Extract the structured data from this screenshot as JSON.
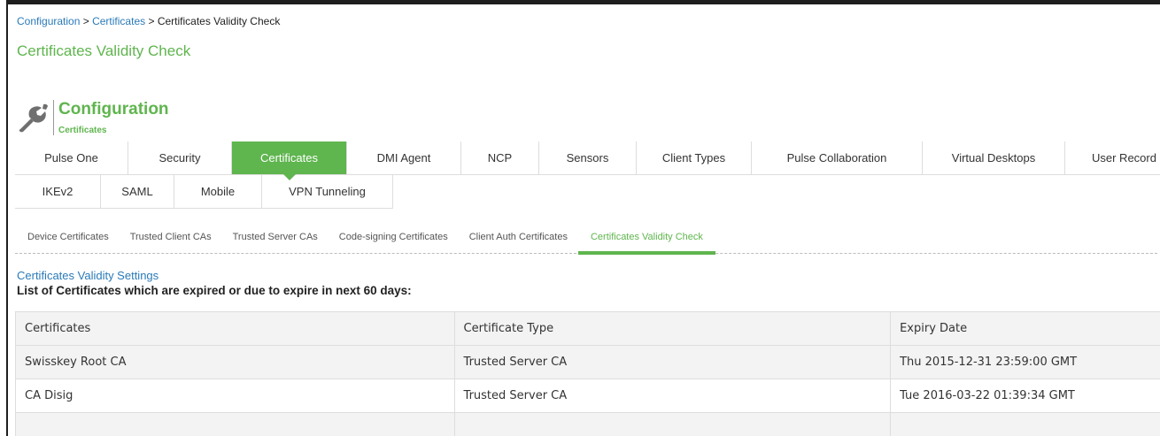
{
  "breadcrumb": {
    "items": [
      "Configuration",
      "Certificates",
      "Certificates Validity Check"
    ],
    "separator": ">"
  },
  "page_title": "Certificates Validity Check",
  "section": {
    "icon": "wrench-icon",
    "title": "Configuration",
    "subtitle": "Certificates"
  },
  "tabs_row1": [
    {
      "label": "Pulse One",
      "active": false
    },
    {
      "label": "Security",
      "active": false
    },
    {
      "label": "Certificates",
      "active": true
    },
    {
      "label": "DMI Agent",
      "active": false
    },
    {
      "label": "NCP",
      "active": false
    },
    {
      "label": "Sensors",
      "active": false
    },
    {
      "label": "Client Types",
      "active": false
    },
    {
      "label": "Pulse Collaboration",
      "active": false
    },
    {
      "label": "Virtual Desktops",
      "active": false
    },
    {
      "label": "User Record S",
      "active": false
    }
  ],
  "tabs_row2": [
    {
      "label": "IKEv2",
      "active": false
    },
    {
      "label": "SAML",
      "active": false
    },
    {
      "label": "Mobile",
      "active": false
    },
    {
      "label": "VPN Tunneling",
      "active": false
    }
  ],
  "subtabs": [
    {
      "label": "Device Certificates",
      "active": false
    },
    {
      "label": "Trusted Client CAs",
      "active": false
    },
    {
      "label": "Trusted Server CAs",
      "active": false
    },
    {
      "label": "Code-signing Certificates",
      "active": false
    },
    {
      "label": "Client Auth Certificates",
      "active": false
    },
    {
      "label": "Certificates Validity Check",
      "active": true
    }
  ],
  "settings_link": "Certificates Validity Settings",
  "list_title": "List of Certificates which are expired or due to expire in next 60 days:",
  "table": {
    "headers": [
      "Certificates",
      "Certificate Type",
      "Expiry Date"
    ],
    "rows": [
      [
        "Swisskey Root CA",
        "Trusted Server CA",
        "Thu 2015-12-31 23:59:00 GMT"
      ],
      [
        "CA Disig",
        "Trusted Server CA",
        "Tue 2016-03-22 01:39:34 GMT"
      ],
      [
        "",
        "",
        ""
      ]
    ]
  },
  "colors": {
    "accent_green": "#5fb54e",
    "link_blue": "#2a7ab8"
  }
}
